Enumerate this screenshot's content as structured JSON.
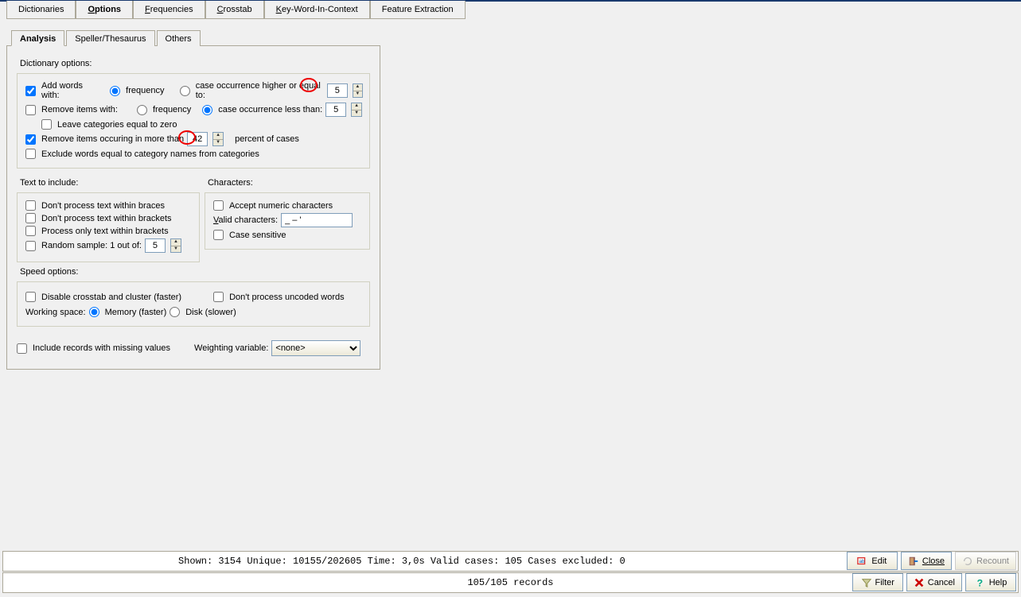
{
  "main_tabs": {
    "dictionaries": "Dictionaries",
    "options": "Options",
    "frequencies": "Frequencies",
    "crosstab": "Crosstab",
    "kwic": "Key-Word-In-Context",
    "feature": "Feature Extraction"
  },
  "sub_tabs": {
    "analysis": "Analysis",
    "speller": "Speller/Thesaurus",
    "others": "Others"
  },
  "dict_opts": {
    "header": "Dictionary options:",
    "add_words": "Add words with:",
    "frequency": "frequency",
    "case_occ_higher": "case occurrence higher or equal to:",
    "add_words_val": "5",
    "remove_items": "Remove items with:",
    "case_occ_less": "case occurrence less than:",
    "remove_items_val": "5",
    "leave_cat": "Leave categories equal to zero",
    "remove_more": "Remove items occuring in more than",
    "remove_more_val": "42",
    "percent_cases": "percent of cases",
    "exclude_names": "Exclude words equal to category names from categories"
  },
  "text_include": {
    "header": "Text to include:",
    "braces": "Don't process text within braces",
    "brackets": "Don't process text within brackets",
    "only_brackets": "Process only text within brackets",
    "random": "Random sample: 1 out of:",
    "random_val": "5"
  },
  "chars": {
    "header": "Characters:",
    "numeric": "Accept numeric characters",
    "valid_label": "Valid characters:",
    "valid_val": "_ – '",
    "case_sens": "Case sensitive"
  },
  "speed": {
    "header": "Speed options:",
    "disable_crosstab": "Disable crosstab and cluster (faster)",
    "dont_uncoded": "Don't process uncoded words",
    "working_space": "Working space:",
    "memory": "Memory (faster)",
    "disk": "Disk (slower)"
  },
  "footer_opts": {
    "include_missing": "Include records with missing values",
    "weighting": "Weighting variable:",
    "weighting_val": "<none>"
  },
  "status": {
    "line1": "Shown: 3154   Unique: 10155/202605   Time: 3,0s   Valid cases: 105   Cases excluded:  0",
    "line2": "105/105 records"
  },
  "buttons": {
    "edit": "Edit",
    "close": "Close",
    "recount": "Recount",
    "filter": "Filter",
    "cancel": "Cancel",
    "help": "Help"
  }
}
